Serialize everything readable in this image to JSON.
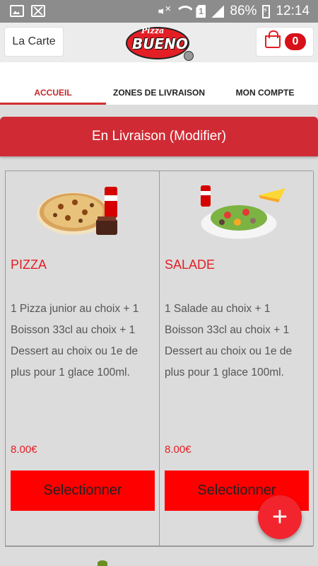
{
  "status_bar": {
    "battery": "86%",
    "time": "12:14",
    "sim_label": "1"
  },
  "header": {
    "menu_label": "La Carte",
    "logo_top": "Pizza",
    "logo_main": "BUENO",
    "cart_count": "0"
  },
  "tabs": [
    {
      "label": "ACCUEIL",
      "active": true
    },
    {
      "label": "ZONES DE LIVRAISON",
      "active": false
    },
    {
      "label": "MON COMPTE",
      "active": false
    }
  ],
  "delivery_banner": "En Livraison (Modifier)",
  "products": [
    {
      "title": "PIZZA",
      "description": "1 Pizza junior au choix  + 1 Boisson 33cl au choix  + 1 Dessert au choix ou 1e de plus pour 1 glace 100ml.",
      "price": "8.00€",
      "button": "Selectionner",
      "image": "pizza-menu-image"
    },
    {
      "title": "SALADE",
      "description": "1 Salade au choix  + 1 Boisson 33cl au choix  + 1 Dessert au choix ou 1e de plus pour 1 glace 100ml.",
      "price": "8.00€",
      "button": "Selectionner",
      "image": "salad-menu-image"
    }
  ],
  "fab": "+",
  "colors": {
    "accent": "#e31e24",
    "button": "#ff0000",
    "banner": "#d02b35",
    "status_bar": "#8c8c8c"
  }
}
